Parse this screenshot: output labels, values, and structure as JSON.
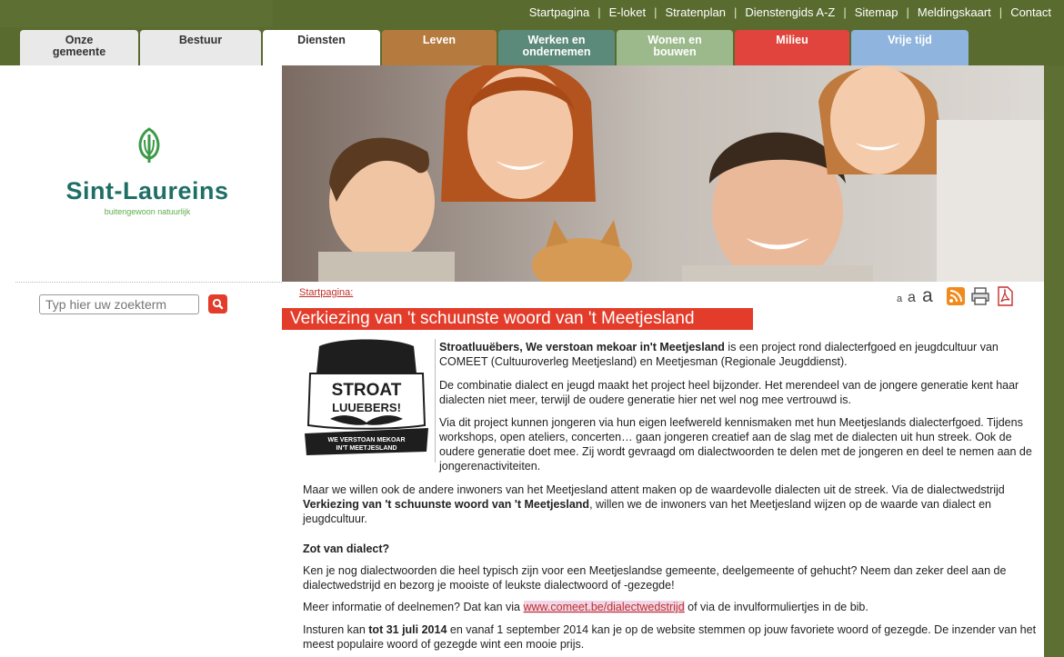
{
  "top_links": [
    "Startpagina",
    "E-loket",
    "Stratenplan",
    "Dienstengids A-Z",
    "Sitemap",
    "Meldingskaart",
    "Contact"
  ],
  "nav": [
    {
      "line1": "Onze",
      "line2": "gemeente",
      "bg": "#e9e9e9",
      "fg": "#333333"
    },
    {
      "line1": "Bestuur",
      "line2": "",
      "bg": "#e9e9e9",
      "fg": "#333333"
    },
    {
      "line1": "Diensten",
      "line2": "",
      "bg": "#ffffff",
      "fg": "#333333"
    },
    {
      "line1": "Leven",
      "line2": "",
      "bg": "#b47a3e",
      "fg": "#ffffff"
    },
    {
      "line1": "Werken en",
      "line2": "ondernemen",
      "bg": "#5c8a7a",
      "fg": "#ffffff"
    },
    {
      "line1": "Wonen en",
      "line2": "bouwen",
      "bg": "#9bb98a",
      "fg": "#ffffff"
    },
    {
      "line1": "Milieu",
      "line2": "",
      "bg": "#e0443c",
      "fg": "#ffffff"
    },
    {
      "line1": "Vrije tijd",
      "line2": "",
      "bg": "#8fb4dd",
      "fg": "#ffffff"
    }
  ],
  "logo": {
    "title": "Sint-Laureins",
    "subtitle": "buitengewoon natuurlijk"
  },
  "search": {
    "placeholder": "Typ hier uw zoekterm"
  },
  "breadcrumb": "Startpagina:",
  "font_sizes": [
    "a",
    "a",
    "a"
  ],
  "page_title": "Verkiezing van 't schuunste woord van 't Meetjesland",
  "stroat_logo": {
    "line1": "STROAT",
    "line2": "LUUEBERS!",
    "ribbon1": "WE VERSTOAN MEKOAR",
    "ribbon2": "IN'T MEETJESLAND"
  },
  "p1_bold": "Stroatluuëbers, We verstoan mekoar in't Meetjesland",
  "p1_rest": " is een project rond dialecterfgoed en jeugdcultuur van COMEET (Cultuuroverleg Meetjesland) en Meetjesman (Regionale Jeugddienst).",
  "p2": "De combinatie dialect en jeugd maakt het project heel bijzonder. Het merendeel van de jongere generatie kent haar dialecten niet meer, terwijl de oudere generatie hier net wel nog mee vertrouwd is.",
  "p3": "Via dit project kunnen jongeren via hun eigen leefwereld kennismaken met hun Meetjeslands dialecterfgoed. Tijdens workshops, open ateliers, concerten… gaan jongeren creatief aan de slag met de dialecten uit hun streek. Ook de oudere generatie doet mee. Zij wordt gevraagd om dialectwoorden te delen met de jongeren en deel te nemen aan de jongerenactiviteiten.",
  "p4_a": "Maar we willen ook de andere inwoners van het Meetjesland attent maken op de waardevolle dialecten uit de streek. Via de dialectwedstrijd ",
  "p4_bold": "Verkiezing van 't schuunste woord van 't Meetjesland",
  "p4_b": ", willen we de inwoners van het Meetjesland wijzen op de waarde van dialect en jeugdcultuur.",
  "h_zot": "Zot van dialect?",
  "p5": "Ken je nog dialectwoorden die heel typisch zijn voor een Meetjeslandse gemeente, deelgemeente of gehucht? Neem dan zeker deel aan de dialectwedstrijd en bezorg je mooiste of leukste dialectwoord of -gezegde!",
  "p6_a": "Meer informatie of deelnemen? Dat kan via ",
  "p6_link": "www.comeet.be/dialectwedstrijd",
  "p6_b": " of via de invulformuliertjes in de bib.",
  "p7_a": "Insturen kan ",
  "p7_bold": "tot 31 juli 2014",
  "p7_b": " en vanaf 1 september 2014 kan je op de website stemmen op jouw favoriete woord of gezegde. De inzender van het meest populaire woord of gezegde wint een mooie prijs."
}
